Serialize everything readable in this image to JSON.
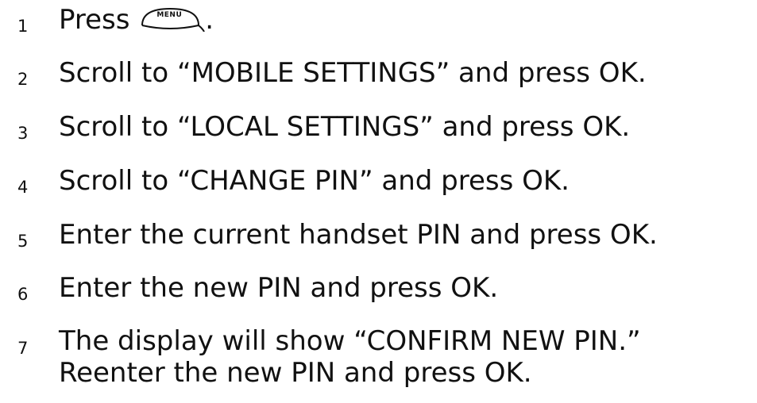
{
  "steps": [
    {
      "number": "1",
      "text_before": "Press ",
      "button_label": "MENU",
      "text_after": "."
    },
    {
      "number": "2",
      "text": "Scroll to “MOBILE SETTINGS” and press OK."
    },
    {
      "number": "3",
      "text": "Scroll to “LOCAL SETTINGS” and press OK."
    },
    {
      "number": "4",
      "text": "Scroll to “CHANGE PIN” and press OK."
    },
    {
      "number": "5",
      "text": "Enter the current handset PIN and press OK."
    },
    {
      "number": "6",
      "text": "Enter the new PIN and press OK."
    },
    {
      "number": "7",
      "text": "The display will show “CONFIRM NEW PIN.” Reenter the new PIN and press OK."
    }
  ]
}
